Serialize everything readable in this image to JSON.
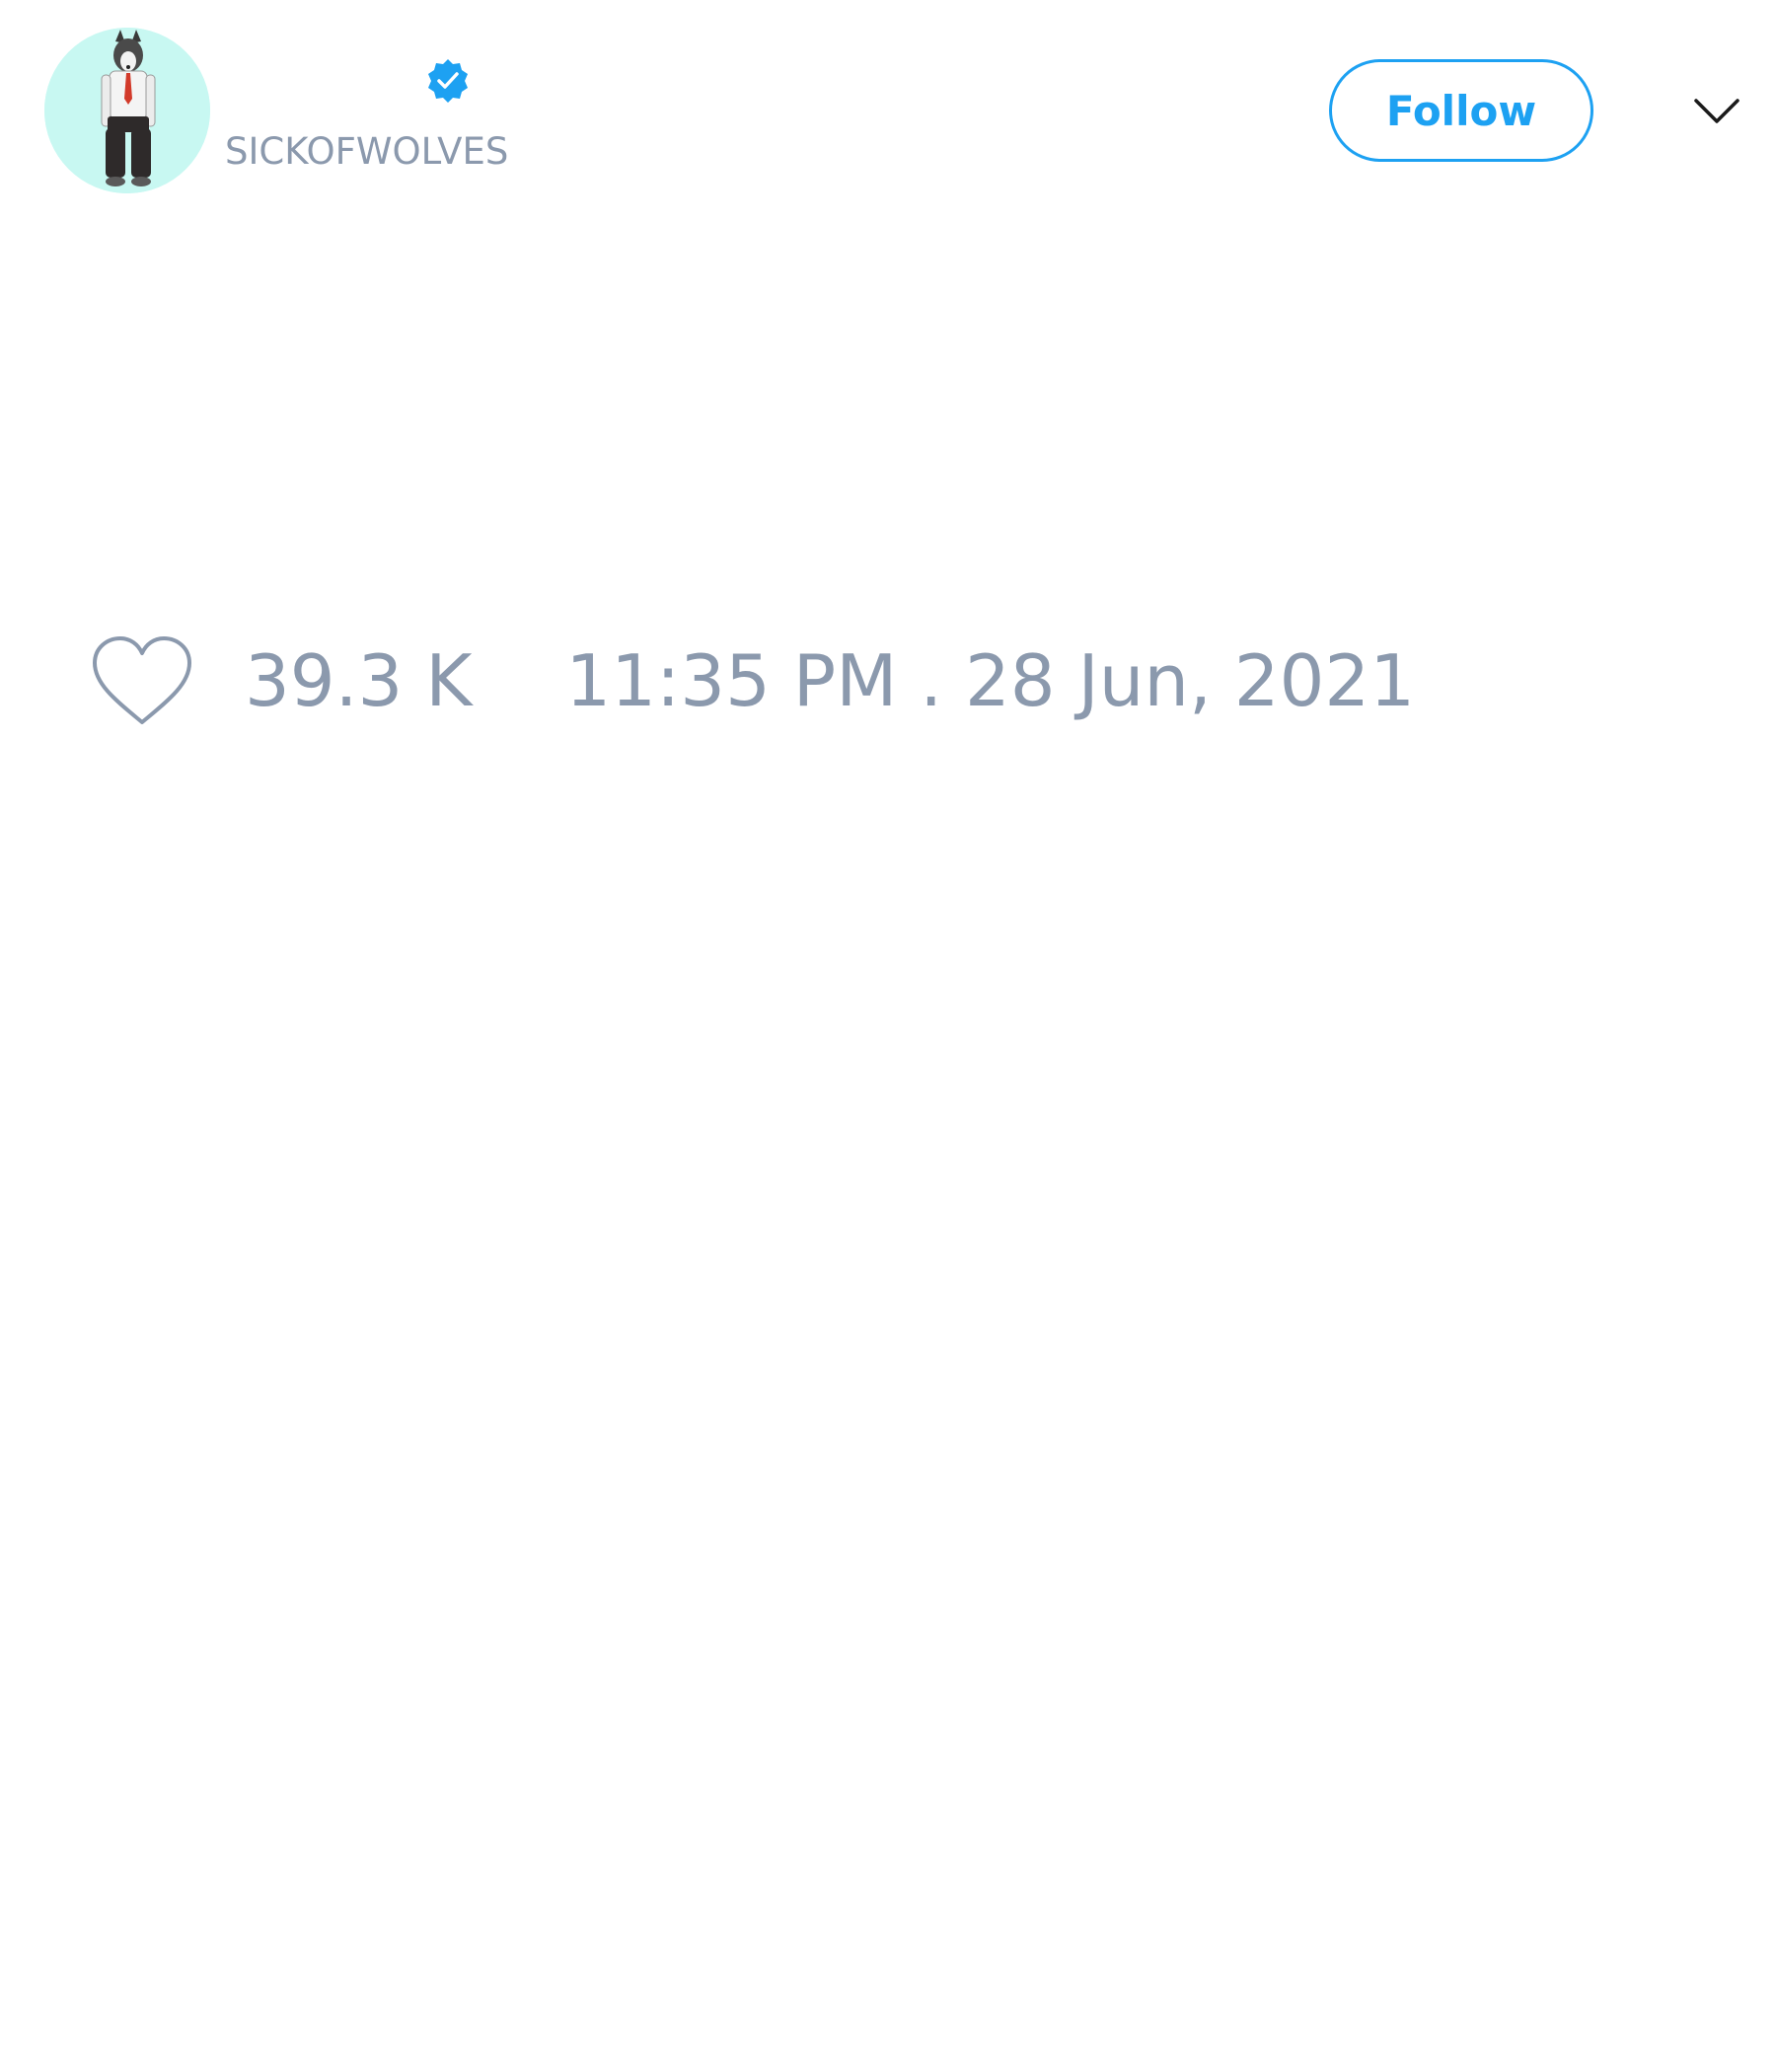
{
  "author": {
    "handle": "SICKOFWOLVES",
    "verified": true,
    "avatar_icon": "wolf-character-avatar",
    "avatar_background": "#c8f8f2"
  },
  "header": {
    "follow_label": "Follow",
    "menu_icon": "chevron-down-icon"
  },
  "tweet": {
    "likes": "39.3 K",
    "timestamp": "11:35 PM . 28 Jun, 2021"
  },
  "colors": {
    "accent": "#1da1f2",
    "muted_text": "#8b99ad",
    "background": "#ffffff"
  }
}
